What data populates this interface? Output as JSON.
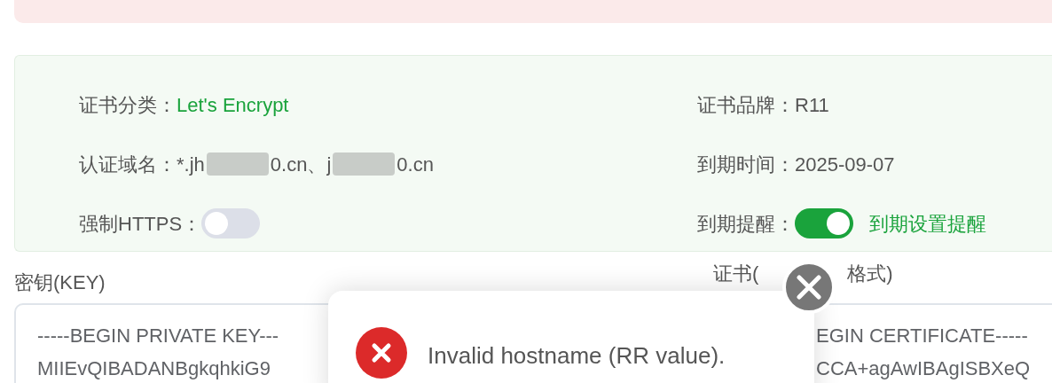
{
  "info": {
    "category": {
      "label": "证书分类：",
      "value": "Let's Encrypt"
    },
    "brand": {
      "label": "证书品牌：",
      "value": "R11"
    },
    "domains": {
      "label": "认证域名：",
      "parts": [
        "*.jh",
        "0.cn、j",
        "0.cn"
      ]
    },
    "expiry": {
      "label": "到期时间：",
      "value": "2025-09-07"
    },
    "force_https": {
      "label": "强制HTTPS：",
      "on": false
    },
    "reminder": {
      "label": "到期提醒：",
      "on": true,
      "link": "到期设置提醒"
    }
  },
  "key": {
    "label": "密钥(KEY)",
    "lines": [
      "-----BEGIN PRIVATE KEY---",
      "MIIEvQIBADANBgkqhkiG9"
    ]
  },
  "certificate": {
    "label_parts": [
      "证书(",
      "格式)"
    ],
    "lines": [
      "EGIN CERTIFICATE-----",
      "CCA+agAwIBAgISBXeQ"
    ]
  },
  "toast": {
    "kind": "error",
    "message": "Invalid hostname (RR value)."
  }
}
